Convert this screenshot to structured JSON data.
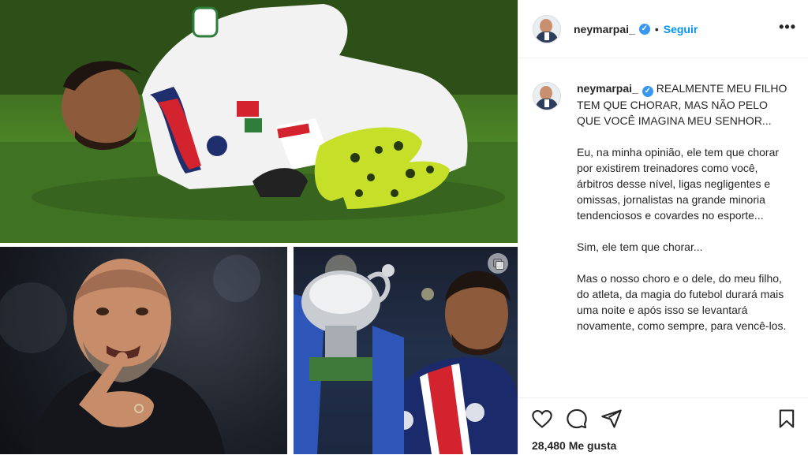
{
  "post": {
    "username": "neymarpai_",
    "verified": true,
    "follow_label": "Seguir",
    "more_label": "•••",
    "caption_title": "REALMENTE MEU FILHO TEM QUE CHORAR, MAS NÃO PELO QUE VOCÊ IMAGINA MEU SENHOR...",
    "caption_body": "Eu, na minha opinião, ele tem que chorar por existirem treinadores como você, árbitros desse nível, ligas negligentes e omissas, jornalistas na grande minoria tendenciosos e covardes no esporte...\n\nSim, ele tem que chorar...\n\nMas o nosso choro e o dele, do meu filho, do atleta, da magia do futebol durará mais uma noite e após isso se levantará novamente, como sempre, para vencê-los.",
    "likes_count": "28,480",
    "likes_label": "Me gusta"
  },
  "images": {
    "top": "player-injured-on-pitch",
    "left": "coach-pointing",
    "right": "player-with-trophy"
  },
  "icons": {
    "like": "heart-icon",
    "comment": "comment-icon",
    "share": "share-icon",
    "save": "bookmark-icon",
    "multi": "carousel-icon"
  },
  "colors": {
    "accent": "#0095f6",
    "verified": "#3897f0",
    "text": "#262626",
    "border": "#efefef"
  }
}
